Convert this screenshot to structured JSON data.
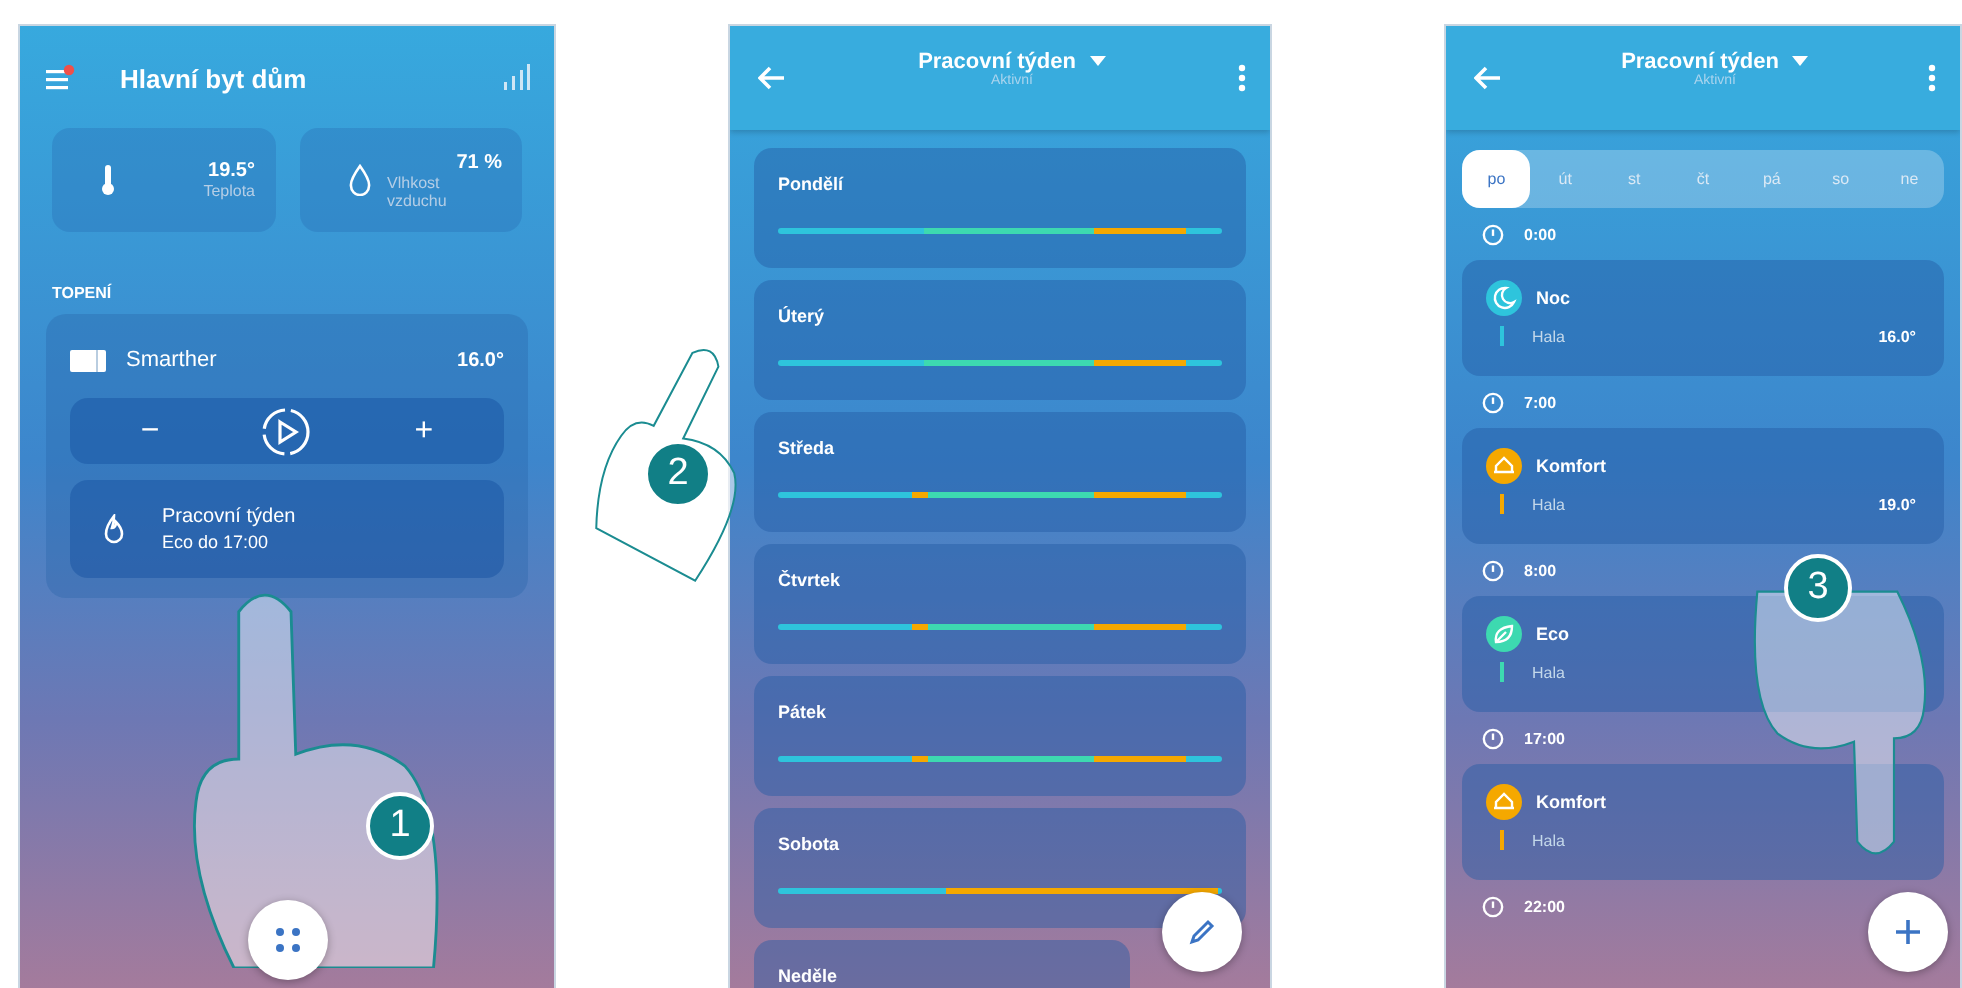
{
  "home_screen": {
    "title": "Hlavní byt dům",
    "has_notification": true,
    "tiles": [
      {
        "kind": "temperature",
        "value": "19.5°",
        "label": "Teplota"
      },
      {
        "kind": "humidity",
        "value": "71 %",
        "label": "Vlhkost vzduchu"
      }
    ],
    "section": "TOPENÍ",
    "thermostat": {
      "name": "Smarther",
      "temperature": "16.0°",
      "minus": "−",
      "plus": "+",
      "program": {
        "name": "Pracovní týden",
        "status": "Eco do 17:00"
      }
    }
  },
  "schedule_screen": {
    "title": "Pracovní týden",
    "subtitle": "Aktivní",
    "days": [
      {
        "name": "Pondělí"
      },
      {
        "name": "Úterý"
      },
      {
        "name": "Středa"
      },
      {
        "name": "Čtvrtek"
      },
      {
        "name": "Pátek"
      },
      {
        "name": "Sobota"
      },
      {
        "name": "Neděle"
      }
    ]
  },
  "day_screen": {
    "title": "Pracovní týden",
    "subtitle": "Aktivní",
    "days": [
      {
        "label": "po",
        "selected": true
      },
      {
        "label": "út",
        "selected": false
      },
      {
        "label": "st",
        "selected": false
      },
      {
        "label": "čt",
        "selected": false
      },
      {
        "label": "pá",
        "selected": false
      },
      {
        "label": "so",
        "selected": false
      },
      {
        "label": "ne",
        "selected": false
      }
    ],
    "entries": [
      {
        "time": "0:00",
        "kind": "night",
        "mode": "Noc",
        "zone": "Hala",
        "temperature": "16.0°",
        "color": "#2ec4dc"
      },
      {
        "time": "7:00",
        "kind": "comfort",
        "mode": "Komfort",
        "zone": "Hala",
        "temperature": "19.0°",
        "color": "#f5a800"
      },
      {
        "time": "8:00",
        "kind": "eco",
        "mode": "Eco",
        "zone": "Hala",
        "color": "#3dd9b0"
      },
      {
        "time": "17:00",
        "kind": "comfort",
        "mode": "Komfort",
        "zone": "Hala",
        "color": "#f5a800"
      },
      {
        "time": "22:00"
      }
    ]
  },
  "steps": [
    "1",
    "2",
    "3"
  ]
}
